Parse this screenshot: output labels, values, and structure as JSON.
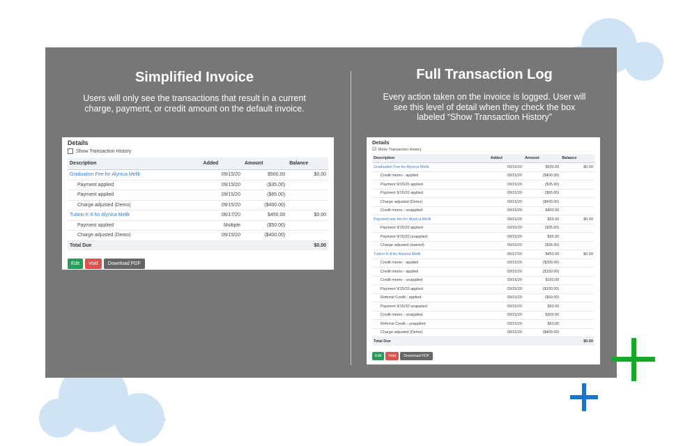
{
  "colors": {
    "panel": "#777777",
    "cloud": "#cfe3f5",
    "green_plus": "#1aa82b",
    "blue_plus": "#1a74c9",
    "link": "#3a7dc9",
    "edit": "#2c9a5a",
    "void": "#d9534f",
    "pdf": "#666666"
  },
  "left": {
    "title": "Simplified Invoice",
    "subtitle_line1": "Users will only see the transactions that result in a current",
    "subtitle_line2": "charge, payment, or credit amount on the default invoice.",
    "card": {
      "heading": "Details",
      "checkbox_label": "Show Transaction History",
      "checkbox_checked": false,
      "columns": [
        "Description",
        "Added",
        "Amount",
        "Balance"
      ],
      "rows": [
        {
          "desc": "Graduation Fee for Alynica Mellk",
          "added": "09/15/20",
          "amount": "$500.00",
          "balance": "$0.00",
          "type": "link"
        },
        {
          "desc": "Payment applied",
          "added": "09/15/20",
          "amount": "($35.00)",
          "balance": "",
          "type": "sub"
        },
        {
          "desc": "Payment applied",
          "added": "09/15/20",
          "amount": "($65.00)",
          "balance": "",
          "type": "sub"
        },
        {
          "desc": "Charge adjusted (Demo)",
          "added": "09/15/20",
          "amount": "($400.00)",
          "balance": "",
          "type": "sub"
        },
        {
          "desc": "Tuition K-8 for Alynica Mellk",
          "added": "06/17/20",
          "amount": "$450.00",
          "balance": "$0.00",
          "type": "link"
        },
        {
          "desc": "Payment applied",
          "added": "Multiple",
          "amount": "($50.00)",
          "balance": "",
          "type": "sub"
        },
        {
          "desc": "Charge adjusted (Demo)",
          "added": "09/15/20",
          "amount": "($400.00)",
          "balance": "",
          "type": "sub"
        }
      ],
      "total_label": "Total Due",
      "total_value": "$0.00",
      "buttons": {
        "edit": "Edit",
        "void": "Void",
        "pdf": "Download PDF"
      }
    }
  },
  "right": {
    "title": "Full Transaction Log",
    "subtitle_line1": "Every action taken on the invoice is logged. User will",
    "subtitle_line2": "see this level of detail when they check the box",
    "subtitle_line3": "labeled “Show Transaction History”",
    "card": {
      "heading": "Details",
      "checkbox_label": "Show Transaction History",
      "checkbox_checked": true,
      "checkbox_mark": "☑",
      "columns": [
        "Description",
        "Added",
        "Amount",
        "Balance"
      ],
      "rows": [
        {
          "desc": "Graduation Fee for Alynica Mellk",
          "added": "09/15/20",
          "amount": "$500.00",
          "balance": "$0.00",
          "type": "link"
        },
        {
          "desc": "Credit memo - applied",
          "added": "09/15/20",
          "amount": "($400.00)",
          "balance": "",
          "type": "sub"
        },
        {
          "desc": "Payment 9/15/20 applied",
          "added": "09/15/20",
          "amount": "($35.00)",
          "balance": "",
          "type": "sub"
        },
        {
          "desc": "Payment 9/15/20 applied",
          "added": "09/15/20",
          "amount": "($65.00)",
          "balance": "",
          "type": "sub"
        },
        {
          "desc": "Charge adjusted (Demo)",
          "added": "09/15/20",
          "amount": "($400.00)",
          "balance": "",
          "type": "sub"
        },
        {
          "desc": "Credit memo - unapplied",
          "added": "09/15/20",
          "amount": "$400.00",
          "balance": "",
          "type": "sub"
        },
        {
          "desc": "Payment late fee for Alynica Mellk",
          "added": "09/15/20",
          "amount": "$35.00",
          "balance": "$0.00",
          "type": "link"
        },
        {
          "desc": "Payment 9/15/20 applied",
          "added": "09/15/20",
          "amount": "($35.00)",
          "balance": "",
          "type": "sub"
        },
        {
          "desc": "Payment 9/15/20 unapplied",
          "added": "09/15/20",
          "amount": "$35.00",
          "balance": "",
          "type": "sub"
        },
        {
          "desc": "Charge adjusted (waived)",
          "added": "09/15/20",
          "amount": "($35.00)",
          "balance": "",
          "type": "sub"
        },
        {
          "desc": "Tuition K-8 for Alynica Mellk",
          "added": "06/17/20",
          "amount": "$450.00",
          "balance": "$0.00",
          "type": "link"
        },
        {
          "desc": "Credit memo - applied",
          "added": "09/15/20",
          "amount": "($300.00)",
          "balance": "",
          "type": "sub"
        },
        {
          "desc": "Credit memo - applied",
          "added": "09/15/20",
          "amount": "($150.00)",
          "balance": "",
          "type": "sub"
        },
        {
          "desc": "Credit memo - unapplied",
          "added": "09/15/20",
          "amount": "$150.00",
          "balance": "",
          "type": "sub"
        },
        {
          "desc": "Payment 9/15/20 applied",
          "added": "09/15/20",
          "amount": "($100.00)",
          "balance": "",
          "type": "sub"
        },
        {
          "desc": "Referral Credit - applied",
          "added": "09/15/20",
          "amount": "($50.00)",
          "balance": "",
          "type": "sub"
        },
        {
          "desc": "Payment 9/15/20 unapplied",
          "added": "09/15/20",
          "amount": "$50.00",
          "balance": "",
          "type": "sub"
        },
        {
          "desc": "Credit memo - unapplied",
          "added": "09/15/20",
          "amount": "$300.00",
          "balance": "",
          "type": "sub"
        },
        {
          "desc": "Referral Credit - unapplied",
          "added": "09/15/20",
          "amount": "$50.00",
          "balance": "",
          "type": "sub"
        },
        {
          "desc": "Charge adjusted (Demo)",
          "added": "09/15/20",
          "amount": "($400.00)",
          "balance": "",
          "type": "sub"
        }
      ],
      "total_label": "Total Due",
      "total_value": "$0.00",
      "buttons": {
        "edit": "Edit",
        "void": "Void",
        "pdf": "Download PDF"
      }
    }
  }
}
